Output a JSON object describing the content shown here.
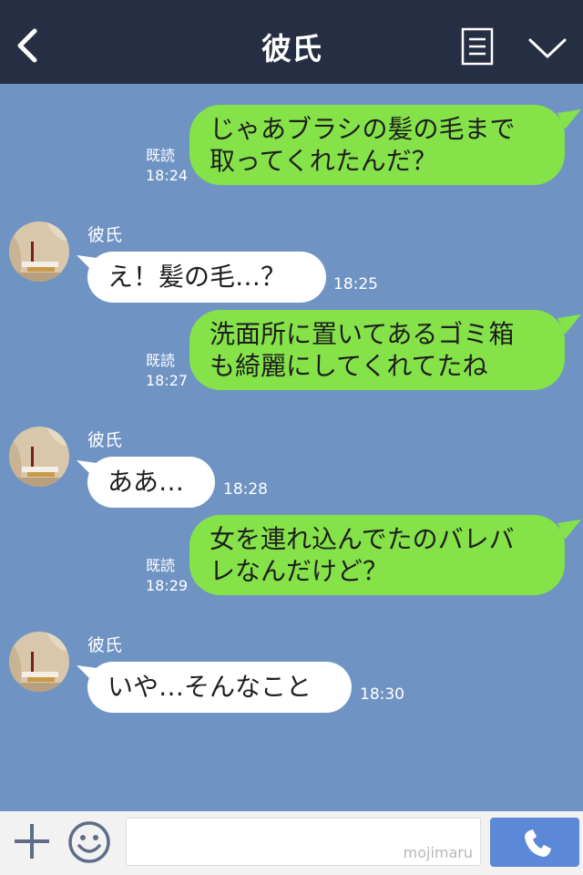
{
  "header": {
    "title": "彼氏"
  },
  "messages": [
    {
      "side": "right",
      "lines": [
        "じゃあブラシの髪の毛まで",
        "取ってくれたんだ？"
      ],
      "read": "既読",
      "time": "18:24"
    },
    {
      "side": "left",
      "name": "彼氏",
      "text": "え！髪の毛…？",
      "time": "18:25"
    },
    {
      "side": "right",
      "lines": [
        "洗面所に置いてあるゴミ箱",
        "も綺麗にしてくれてたね"
      ],
      "read": "既読",
      "time": "18:27"
    },
    {
      "side": "left",
      "name": "彼氏",
      "text": "ああ…",
      "time": "18:28"
    },
    {
      "side": "right",
      "lines": [
        "女を連れ込んでたのバレバ",
        "レなんだけど？"
      ],
      "read": "既読",
      "time": "18:29"
    },
    {
      "side": "left",
      "name": "彼氏",
      "text": "いや…そんなこと",
      "time": "18:30"
    }
  ],
  "composer": {
    "watermark": "mojimaru"
  },
  "colors": {
    "header": "#252e42",
    "chat_bg": "#6f94c3",
    "sent_bubble": "#85e249",
    "received_bubble": "#ffffff",
    "call_button": "#5b88d7"
  },
  "icons": [
    "back-icon",
    "menu-icon",
    "chevron-down-icon",
    "plus-icon",
    "emoji-icon",
    "phone-icon"
  ]
}
